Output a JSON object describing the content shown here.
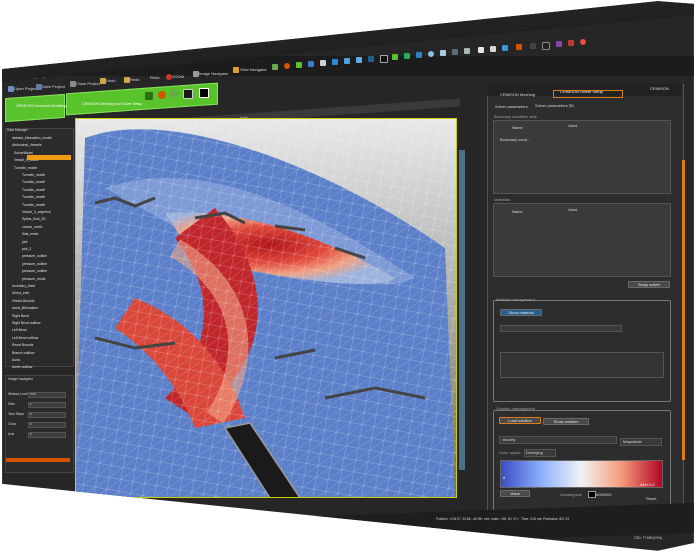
{
  "window": {
    "title": "CRIMSON Meshing and Solver Setup - CRIMSON v.2018.04.13 - [Not for use in diagnosis or treatment of patients]",
    "project_label": "Bopli_Bifigbild.crsl",
    "controls": [
      "-",
      "□",
      "×"
    ]
  },
  "menu": [
    "File",
    "Edit",
    "Window",
    "Help"
  ],
  "toolbar": {
    "open_project": "Open Project",
    "save_project": "Save Project",
    "close_project": "Close Project",
    "undo": "Undo",
    "redo": "Redo",
    "saveto": "Redo",
    "zoom": "ZOOM",
    "image_navigator": "Image Navigator",
    "view_navigator": "View Navigator"
  },
  "tabs": {
    "geometric": "CRIMSON Geometric Modeling",
    "meshing": "CRIMSON Meshing and Solver Setup"
  },
  "view": {
    "header": "Axial"
  },
  "tree": [
    "Data Manager",
    "dataset_bifurcation_model",
    "Abdominal_Vessels",
    "SolverModel",
    "Vessel_1_Model",
    "Tunnels_model",
    "Tunnels_model",
    "Tunnels_model",
    "Tunnels_model",
    "Tunnels_model",
    "Tunnels_model",
    "Vessel_3_segment",
    "Spline_final_3D",
    "coarse_mesh",
    "final_mesh",
    "plot",
    "plot_2",
    "pressure_outline",
    "pressure_outline",
    "pressure_outline",
    "pressure_result",
    "boundary_fixed",
    "Artery_inlet",
    "Vessel-Bounds",
    "Aorta_Bifurcation",
    "Right Bend",
    "Right Bend outflow",
    "Left Bend",
    "Left Bend outflow",
    "Renal Bounds",
    "Branch outflow",
    "Aorta",
    "Aortic outflow"
  ],
  "left_bottom": {
    "header": "Image Navigator",
    "rows": [
      "Window Level",
      "Slice",
      "Time Steps",
      "Cross",
      "Axis"
    ],
    "values": [
      "0.00",
      "1",
      "0",
      "0",
      "0"
    ]
  },
  "right_tabs": [
    "CRIMSON Meshing",
    "CRIMSON Solver Setup",
    "CRIMSON"
  ],
  "solver": {
    "subtabs": [
      "Solver parameters",
      "Solver parameters 3D"
    ],
    "boundary_conditions_label": "Boundary condition sets",
    "bc_columns": [
      "Name",
      "Used"
    ],
    "bc_row": "Boundary cond...",
    "materials_label": "Materials",
    "mat_columns": [
      "Name",
      "Used"
    ],
    "setup_solver": "Setup solver",
    "material_mgmt_label": "Material management",
    "show_material": "Show material",
    "solution_mgmt_label": "Solution management",
    "load_solution": "Load solution",
    "show_solution": "Show solution",
    "solution_select": "velocity",
    "magnitude_select": "Magnitude",
    "color_space_label": "Color space:",
    "color_space_value": "Diverging",
    "min_value": "0",
    "max_value": "44e+1.2",
    "value_btn": "Value",
    "unassigned_label": "Unassigned:",
    "unassigned_color": "#000000",
    "reset": "Reset"
  },
  "statusbar": {
    "position": "Position: <104.97, 33.86, -46.95> mm; Index: <98, 50, 47> ; Time: 0.00 ms; Pixelvalue: 807.23",
    "memory": "CSD: 77 MB (0.9%)"
  },
  "colors": {
    "accent_green": "#58c32a",
    "selection_orange": "#f39c12",
    "viewport_border": "#cbd100",
    "solution_orange": "#e07b1a"
  }
}
